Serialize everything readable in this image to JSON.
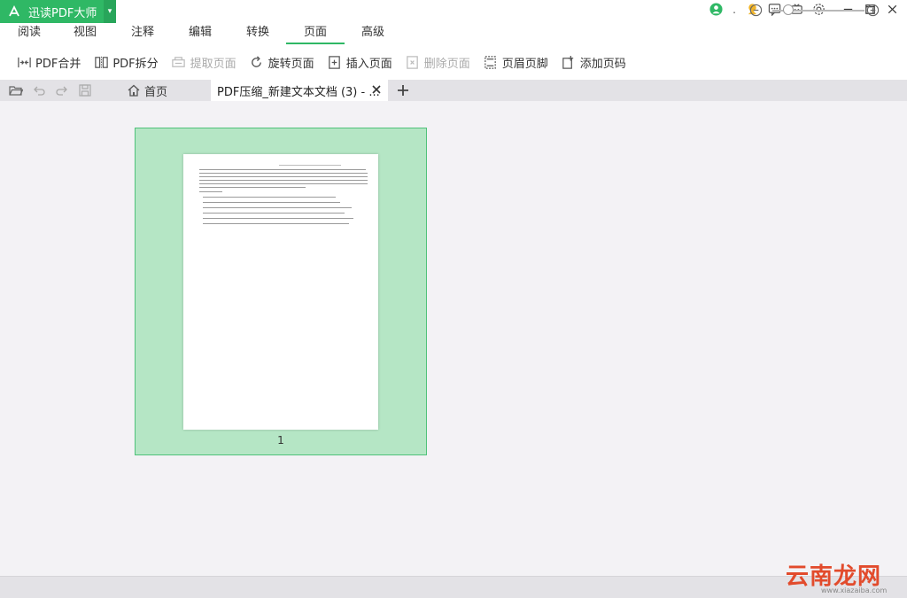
{
  "app": {
    "title": "迅读PDF大师"
  },
  "menu": {
    "tabs": [
      {
        "label": "阅读"
      },
      {
        "label": "视图"
      },
      {
        "label": "注释"
      },
      {
        "label": "编辑"
      },
      {
        "label": "转换"
      },
      {
        "label": "页面"
      },
      {
        "label": "高级"
      }
    ],
    "active": "页面"
  },
  "toolbar": {
    "merge": "PDF合并",
    "split": "PDF拆分",
    "extract": "提取页面",
    "rotate": "旋转页面",
    "insert": "插入页面",
    "delete": "删除页面",
    "header_footer": "页眉页脚",
    "add_page_number": "添加页码"
  },
  "tabs": {
    "home": "首页",
    "file": "PDF压缩_新建文本文档 (3) - ..."
  },
  "canvas": {
    "page_number": "1"
  },
  "watermark": {
    "text": "云南龙网",
    "sub": "www.xiazaiba.com"
  },
  "colors": {
    "accent": "#2fb865",
    "selection": "#b5e6c5"
  }
}
